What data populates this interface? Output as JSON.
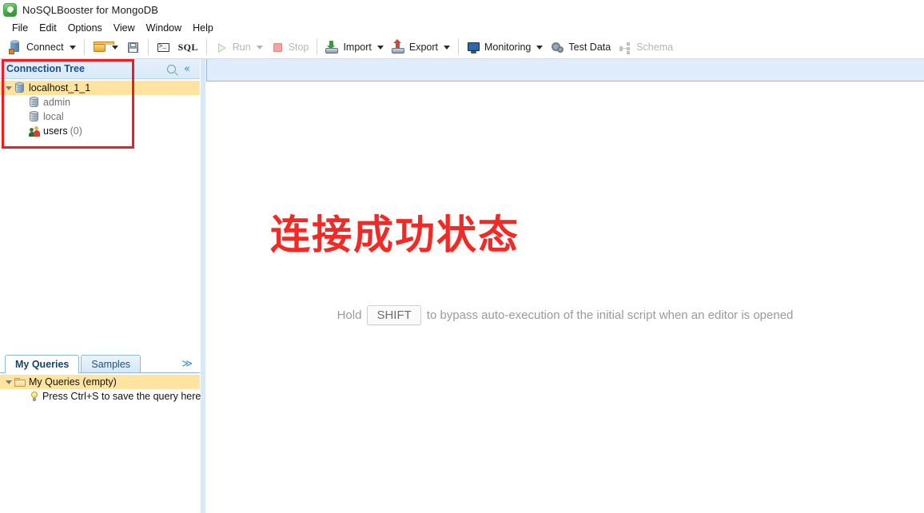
{
  "window": {
    "title": "NoSQLBooster for MongoDB",
    "app_icon": "app-leaf-icon"
  },
  "menubar": {
    "items": [
      "File",
      "Edit",
      "Options",
      "View",
      "Window",
      "Help"
    ]
  },
  "toolbar": {
    "connect": "Connect",
    "run": "Run",
    "stop": "Stop",
    "import": "Import",
    "export": "Export",
    "monitoring": "Monitoring",
    "test_data": "Test Data",
    "schema": "Schema",
    "sql": "SQL"
  },
  "connection_tree": {
    "header": "Connection Tree",
    "search_icon": "search-icon",
    "collapse_icon": "chevron-double-left-icon",
    "nodes": [
      {
        "label": "localhost_1_1",
        "icon": "server-icon",
        "expanded": true,
        "selected": true,
        "indent": 0,
        "count": ""
      },
      {
        "label": "admin",
        "icon": "database-icon",
        "expanded": false,
        "selected": false,
        "indent": 1,
        "count": ""
      },
      {
        "label": "local",
        "icon": "database-icon",
        "expanded": false,
        "selected": false,
        "indent": 1,
        "count": ""
      },
      {
        "label": "users",
        "icon": "users-icon",
        "expanded": null,
        "selected": false,
        "indent": 1,
        "count": "(0)"
      }
    ],
    "highlight_color": "#ee1d24"
  },
  "queries_panel": {
    "tabs": [
      {
        "label": "My Queries",
        "active": true
      },
      {
        "label": "Samples",
        "active": false
      }
    ],
    "overflow_icon": "chevron-double-down-icon",
    "rows": [
      {
        "label": "My Queries (empty)",
        "icon": "folder-icon",
        "selected": true,
        "indent": 0
      },
      {
        "label": "Press Ctrl+S to save the query here",
        "icon": "lightbulb-icon",
        "selected": false,
        "indent": 1
      }
    ]
  },
  "main": {
    "overlay_text": "连接成功状态",
    "overlay_color": "#ee2b26",
    "hint_prefix": "Hold",
    "hint_key": "SHIFT",
    "hint_suffix": "to bypass auto-execution of the initial script when an editor is opened"
  }
}
